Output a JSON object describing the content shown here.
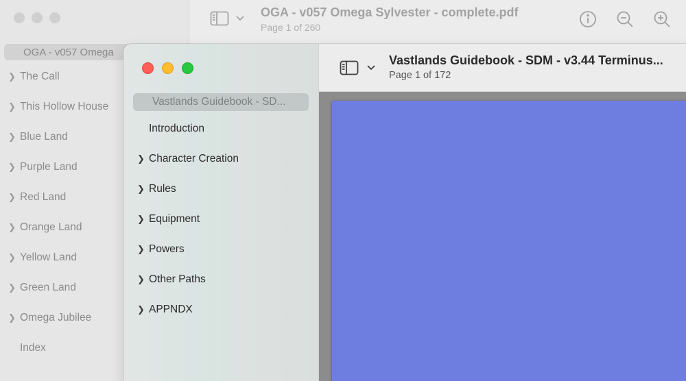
{
  "back_window": {
    "title": "OGA - v057 Omega Sylvester - complete.pdf",
    "subtitle": "Page 1 of 260",
    "sidebar_doc_title": "OGA - v057 Omega",
    "items": [
      {
        "label": "The Call",
        "has_children": true
      },
      {
        "label": "This Hollow House",
        "has_children": true
      },
      {
        "label": "Blue Land",
        "has_children": true
      },
      {
        "label": "Purple Land",
        "has_children": true
      },
      {
        "label": "Red Land",
        "has_children": true
      },
      {
        "label": "Orange Land",
        "has_children": true
      },
      {
        "label": "Yellow Land",
        "has_children": true
      },
      {
        "label": "Green Land",
        "has_children": true
      },
      {
        "label": "Omega Jubilee",
        "has_children": true
      },
      {
        "label": "Index",
        "has_children": false
      }
    ],
    "toolbar_icons": [
      "info-icon",
      "zoom-out-icon",
      "zoom-in-icon"
    ]
  },
  "front_window": {
    "title": "Vastlands Guidebook - SDM - v3.44 Terminus...",
    "subtitle": "Page 1 of 172",
    "sidebar_doc_title": "Vastlands Guidebook - SD...",
    "items": [
      {
        "label": "Introduction",
        "has_children": false
      },
      {
        "label": "Character Creation",
        "has_children": true
      },
      {
        "label": "Rules",
        "has_children": true
      },
      {
        "label": "Equipment",
        "has_children": true
      },
      {
        "label": "Powers",
        "has_children": true
      },
      {
        "label": "Other Paths",
        "has_children": true
      },
      {
        "label": "APPNDX",
        "has_children": true
      }
    ],
    "page_color": "#6e7de0"
  },
  "colors": {
    "close": "#fe5f57",
    "minimize": "#febc2e",
    "zoom": "#28c840"
  }
}
